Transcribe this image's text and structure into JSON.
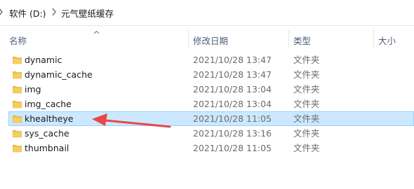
{
  "breadcrumb": {
    "items": [
      "软件 (D:)",
      "元气壁纸缓存"
    ]
  },
  "columns": {
    "name": "名称",
    "modified": "修改日期",
    "type": "类型",
    "size": "大小"
  },
  "files": [
    {
      "name": "dynamic",
      "modified": "2021/10/28 13:47",
      "type": "文件夹",
      "selected": false
    },
    {
      "name": "dynamic_cache",
      "modified": "2021/10/28 13:47",
      "type": "文件夹",
      "selected": false
    },
    {
      "name": "img",
      "modified": "2021/10/28 13:04",
      "type": "文件夹",
      "selected": false
    },
    {
      "name": "img_cache",
      "modified": "2021/10/28 13:04",
      "type": "文件夹",
      "selected": false
    },
    {
      "name": "khealtheye",
      "modified": "2021/10/28 11:05",
      "type": "文件夹",
      "selected": true
    },
    {
      "name": "sys_cache",
      "modified": "2021/10/28 13:16",
      "type": "文件夹",
      "selected": false
    },
    {
      "name": "thumbnail",
      "modified": "2021/10/28 11:05",
      "type": "文件夹",
      "selected": false
    }
  ],
  "colors": {
    "selection_bg": "#cce8ff",
    "selection_border": "#99d1ff",
    "folder": "#f0c24b",
    "annotation_arrow": "#e8474a"
  },
  "icons": {
    "folder": "folder-icon",
    "separator": "chevron-right-icon",
    "sort": "sort-ascending-icon"
  }
}
